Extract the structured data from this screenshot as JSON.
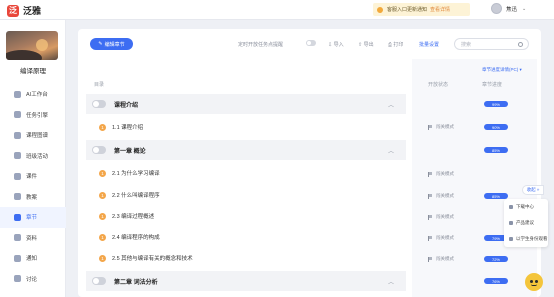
{
  "app": {
    "logo_mark": "泛",
    "name": "泛雅"
  },
  "notice": {
    "text": "客服入口更新通知",
    "link": "查看详情"
  },
  "user": {
    "name": "焦迅",
    "caret": "⌄"
  },
  "sidebar": {
    "course_name": "编译原理",
    "items": [
      {
        "label": "AI工作台",
        "icon": "ai-icon"
      },
      {
        "label": "任务引擎",
        "icon": "task-icon"
      },
      {
        "label": "课程图谱",
        "icon": "graph-icon"
      },
      {
        "label": "班级活动",
        "icon": "activity-icon"
      },
      {
        "label": "课件",
        "icon": "courseware-icon"
      },
      {
        "label": "教案",
        "icon": "lesson-plan-icon"
      },
      {
        "label": "章节",
        "icon": "chapter-icon",
        "active": true
      },
      {
        "label": "资料",
        "icon": "material-icon"
      },
      {
        "label": "通知",
        "icon": "notice-icon"
      },
      {
        "label": "讨论",
        "icon": "discussion-icon"
      }
    ]
  },
  "toolbar": {
    "edit_label": "编辑章节",
    "remind_label": "定时开放任务点提醒",
    "import_label": "导入",
    "export_label": "导出",
    "print_label": "打印",
    "batch_label": "批量设置",
    "search_placeholder": "搜索"
  },
  "outline": {
    "header": "目录",
    "status_header": "开放状态",
    "progress_header": "章节进度",
    "top_link": "章节进度详情(PC) ▾",
    "rows": [
      {
        "type": "chapter",
        "title": "课程介绍",
        "progress": "99%"
      },
      {
        "type": "section",
        "num": "1",
        "title": "1.1 课程介绍",
        "status": "闯关模式",
        "progress": "90%"
      },
      {
        "type": "chapter",
        "title": "第一章 概论",
        "progress": "85%"
      },
      {
        "type": "section",
        "num": "1",
        "title": "2.1 为什么学习编译",
        "status": "闯关模式",
        "progress": ""
      },
      {
        "type": "section",
        "num": "1",
        "title": "2.2 什么叫编译程序",
        "status": "闯关模式",
        "progress": "85%"
      },
      {
        "type": "section",
        "num": "1",
        "title": "2.3 编译过程概述",
        "status": "闯关模式",
        "progress": ""
      },
      {
        "type": "section",
        "num": "1",
        "title": "2.4 编译程序的构成",
        "status": "闯关模式",
        "progress": "79%"
      },
      {
        "type": "section",
        "num": "1",
        "title": "2.5 其他与编译有关的概念和技术",
        "status": "闯关模式",
        "progress": "72%"
      },
      {
        "type": "chapter",
        "title": "第二章 词法分析",
        "progress": "76%"
      }
    ]
  },
  "float": {
    "tab_label": "收起 »",
    "menu": [
      "下载中心",
      "产品建议",
      "以学生身份观看"
    ]
  }
}
